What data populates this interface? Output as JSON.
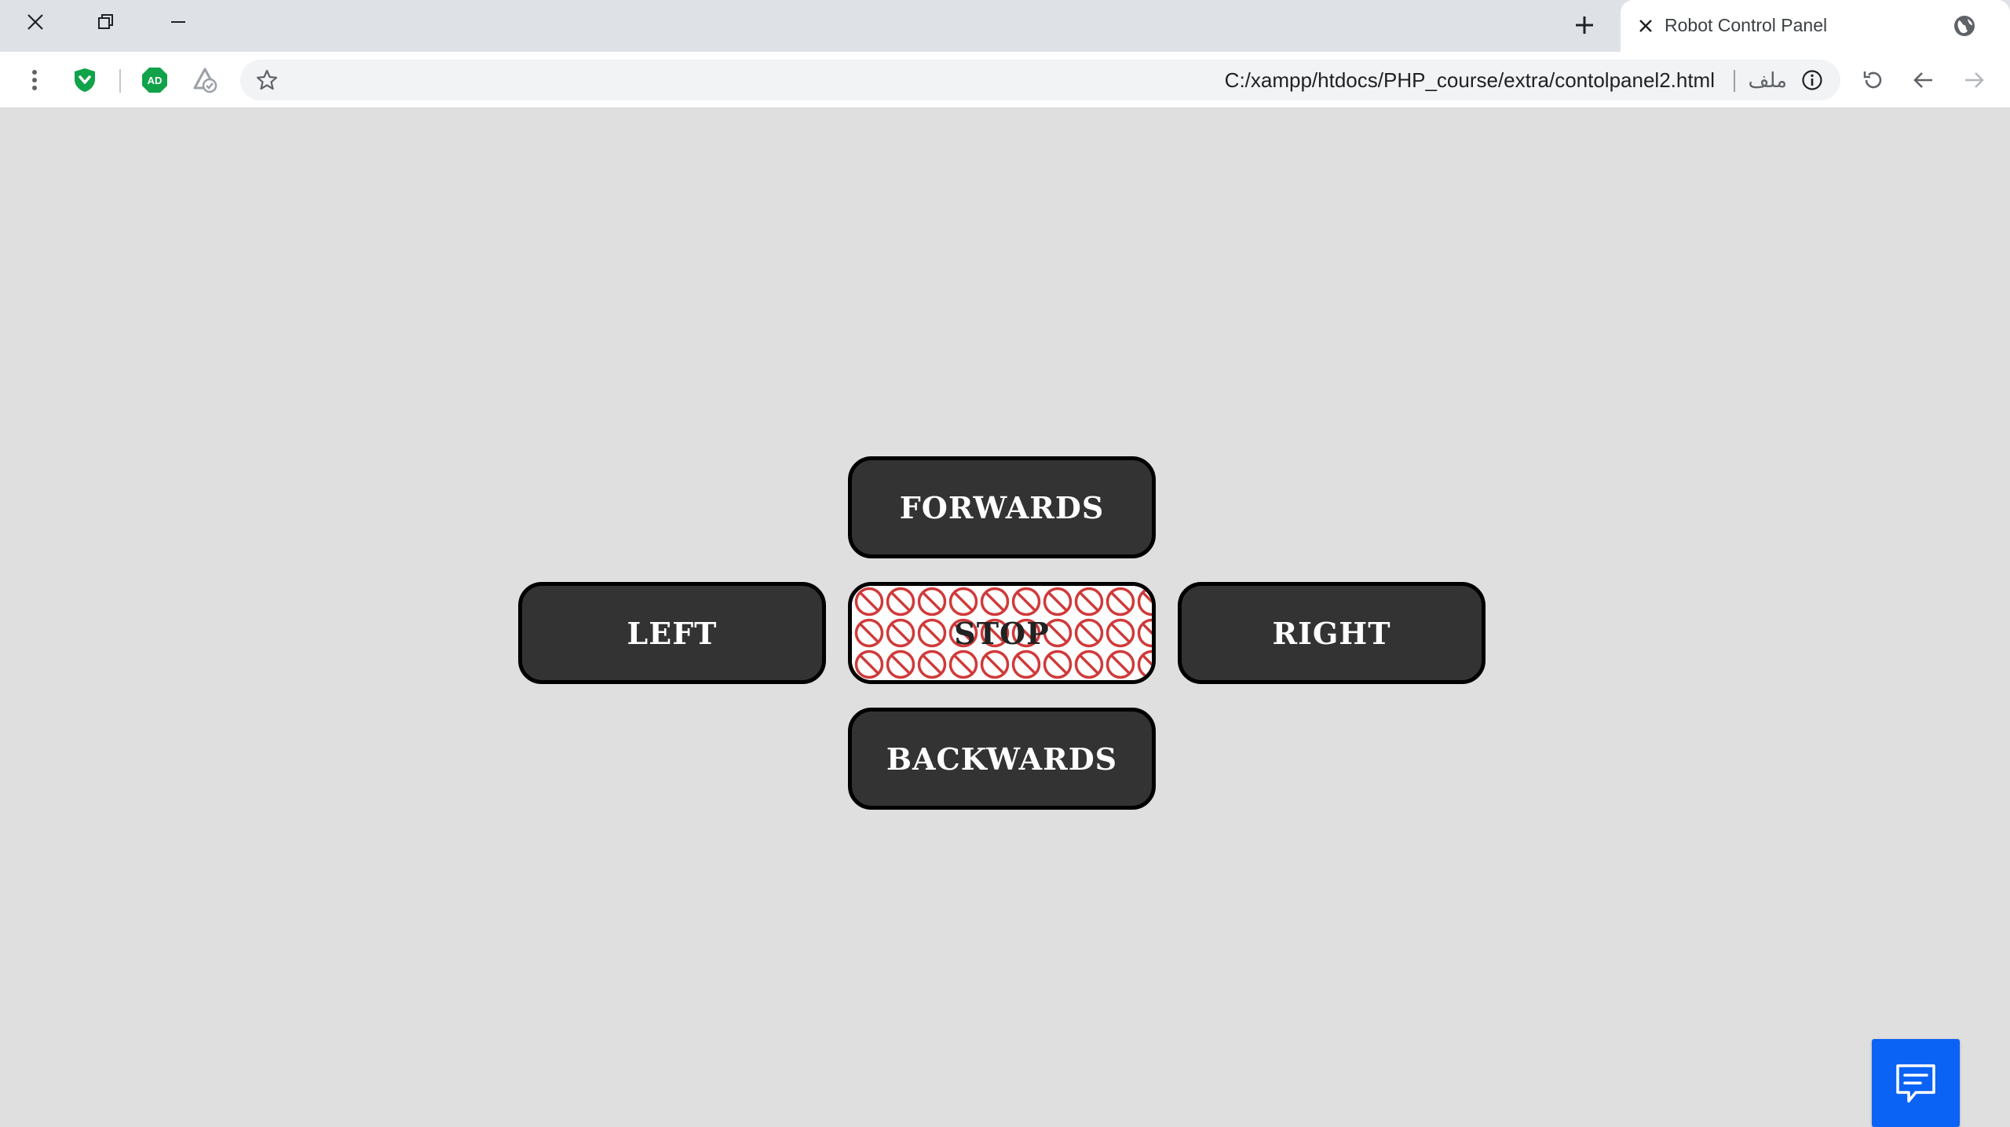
{
  "browser": {
    "tab": {
      "title": "Robot Control Panel",
      "close_icon": "close-icon",
      "favicon": "globe-icon"
    },
    "new_tab_icon": "plus-icon",
    "window_controls": {
      "close_icon": "close-icon",
      "restore_icon": "restore-icon",
      "minimize_icon": "minimize-icon"
    },
    "toolbar": {
      "menu_icon": "kebab-menu-icon",
      "extensions": [
        "shield-icon",
        "adblock-icon",
        "extension-icon"
      ],
      "reload_icon": "reload-icon",
      "back_icon": "back-arrow-icon",
      "forward_icon": "forward-arrow-icon"
    },
    "omnibox": {
      "url": "C:/xampp/htdocs/PHP_course/extra/contolpanel2.html",
      "scheme_label": "ملف",
      "bookmark_icon": "star-icon",
      "info_icon": "info-icon"
    }
  },
  "controls": {
    "forwards": "FORWARDS",
    "left": "LEFT",
    "stop": "STOP",
    "right": "RIGHT",
    "backwards": "BACKWARDS"
  },
  "chat_widget": {
    "icon": "chat-icon"
  },
  "colors": {
    "page_background": "#dfdfdf",
    "button_fill": "#333333",
    "button_border": "#000000",
    "stop_symbol": "#d03a3a",
    "chat_button": "#0a63f5"
  }
}
